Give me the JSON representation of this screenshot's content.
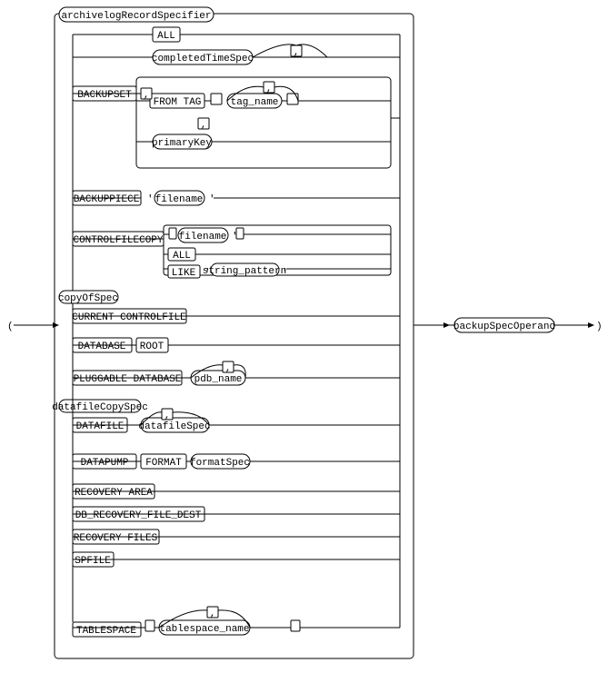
{
  "diagram": {
    "title": "archivelogRecordSpecifier / backupSpecOperand railroad diagram",
    "nodes": {
      "archivelogRecordSpecifier": "archivelogRecordSpecifier",
      "ALL": "ALL",
      "completedTimeSpec": "completedTimeSpec",
      "BACKUPSET": "BACKUPSET",
      "FROM_TAG": "FROM TAG",
      "tag_name": "tag_name",
      "primaryKey": "primaryKey",
      "BACKUPPIECE": "BACKUPPIECE",
      "filename": "filename",
      "CONTROLFILECOPY": "CONTROLFILECOPY",
      "LIKE": "LIKE",
      "string_pattern": "string_pattern",
      "copyOfSpec": "copyOfSpec",
      "CURRENT_CONTROLFILE": "CURRENT CONTROLFILE",
      "backupSpecOperand": "backupSpecOperand",
      "DATABASE": "DATABASE",
      "ROOT": "ROOT",
      "PLUGGABLE_DATABASE": "PLUGGABLE DATABASE",
      "pdb_name": "pdb_name",
      "datafileCopySpec": "datafileCopySpec",
      "DATAFILE": "DATAFILE",
      "datafileSpec": "datafileSpec",
      "DATAPUMP": "DATAPUMP",
      "FORMAT": "FORMAT",
      "formatSpec": "formatSpec",
      "RECOVERY_AREA": "RECOVERY AREA",
      "DB_RECOVERY_FILE_DEST": "DB_RECOVERY_FILE_DEST",
      "RECOVERY_FILES": "RECOVERY FILES",
      "SPFILE": "SPFILE",
      "TABLESPACE": "TABLESPACE",
      "tablespace_name": "tablespace_name"
    }
  }
}
